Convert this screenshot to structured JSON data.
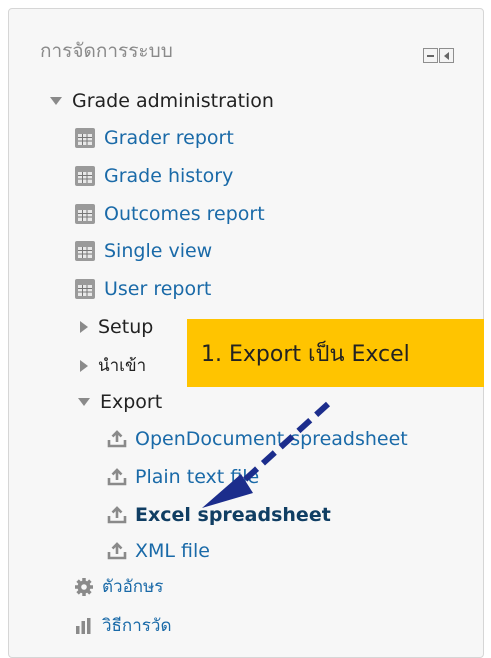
{
  "block": {
    "title": "การจัดการระบบ",
    "controls": [
      "minimize-icon",
      "dock-icon"
    ]
  },
  "tree": {
    "grade_admin": "Grade administration",
    "grader_report": "Grader report",
    "grade_history": "Grade history",
    "outcomes_report": "Outcomes report",
    "single_view": "Single view",
    "user_report": "User report",
    "setup": "Setup",
    "import": "นำเข้า",
    "export": "Export",
    "export_items": {
      "ods": "OpenDocument spreadsheet",
      "txt": "Plain text file",
      "xls": "Excel spreadsheet",
      "xml": "XML file"
    },
    "letters": "ตัวอักษร",
    "scales": "วิธีการวัด"
  },
  "annotation": {
    "callout_text": "1. Export เป็น Excel",
    "callout_color": "#ffc400",
    "arrow_color": "#1c2d8c"
  },
  "colors": {
    "link": "#1a6aa8",
    "text": "#222222",
    "heading": "#8a8a8a"
  }
}
